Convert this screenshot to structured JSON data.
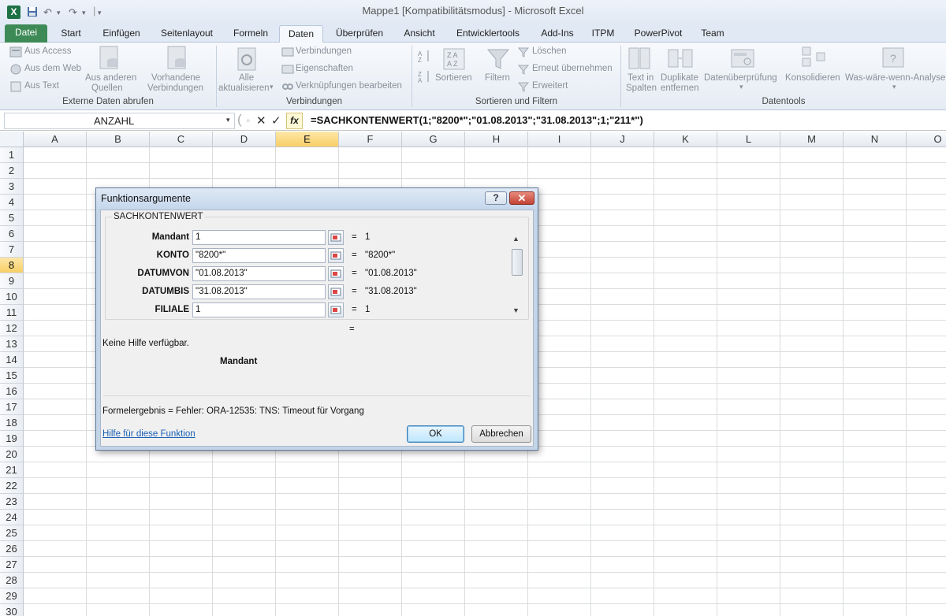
{
  "window": {
    "title": "Mappe1  [Kompatibilitätsmodus]  -  Microsoft Excel",
    "app_icon": "X"
  },
  "quick_access": {
    "save": "save-icon",
    "undo": "undo-icon",
    "redo": "redo-icon"
  },
  "ribbon_tabs": [
    "Datei",
    "Start",
    "Einfügen",
    "Seitenlayout",
    "Formeln",
    "Daten",
    "Überprüfen",
    "Ansicht",
    "Entwicklertools",
    "Add-Ins",
    "ITPM",
    "PowerPivot",
    "Team"
  ],
  "active_tab": "Daten",
  "ribbon": {
    "external": {
      "access": "Aus Access",
      "web": "Aus dem Web",
      "text": "Aus Text",
      "other_1": "Aus anderen",
      "other_2": "Quellen",
      "existing_1": "Vorhandene",
      "existing_2": "Verbindungen",
      "group": "Externe Daten abrufen"
    },
    "connections": {
      "refresh_1": "Alle",
      "refresh_2": "aktualisieren",
      "conn": "Verbindungen",
      "props": "Eigenschaften",
      "links": "Verknüpfungen bearbeiten",
      "group": "Verbindungen"
    },
    "sort": {
      "sort": "Sortieren",
      "filter": "Filtern",
      "clear": "Löschen",
      "reapply": "Erneut übernehmen",
      "advanced": "Erweitert",
      "group": "Sortieren und Filtern"
    },
    "tools": {
      "t2c_1": "Text in",
      "t2c_2": "Spalten",
      "dup_1": "Duplikate",
      "dup_2": "entfernen",
      "validation": "Datenüberprüfung",
      "consolidate": "Konsolidieren",
      "whatif": "Was-wäre-wenn-Analyse",
      "group": "Datentools"
    }
  },
  "formula_bar": {
    "name_box": "ANZAHL",
    "cancel": "✕",
    "enter": "✓",
    "fx": "fx",
    "formula": "=SACHKONTENWERT(1;\"8200*\";\"01.08.2013\";\"31.08.2013\";1;\"211*\")"
  },
  "sheet": {
    "columns": [
      "A",
      "B",
      "C",
      "D",
      "E",
      "F",
      "G",
      "H",
      "I",
      "J",
      "K",
      "L",
      "M",
      "N",
      "O"
    ],
    "selected_column": "E",
    "rows": [
      "1",
      "2",
      "3",
      "4",
      "5",
      "6",
      "7",
      "8",
      "9",
      "10",
      "11",
      "12",
      "13",
      "14",
      "15",
      "16",
      "17",
      "18",
      "19",
      "20",
      "21",
      "22",
      "23",
      "24",
      "25",
      "26",
      "27",
      "28",
      "29",
      "30"
    ],
    "selected_row": "8"
  },
  "dialog": {
    "title": "Funktionsargumente",
    "help_btn": "?",
    "close_btn": "✕",
    "function_name": "SACHKONTENWERT",
    "args": [
      {
        "label": "Mandant",
        "value": "1",
        "result": "1"
      },
      {
        "label": "KONTO",
        "value": "\"8200*\"",
        "result": "\"8200*\""
      },
      {
        "label": "DATUMVON",
        "value": "\"01.08.2013\"",
        "result": "\"01.08.2013\""
      },
      {
        "label": "DATUMBIS",
        "value": "\"31.08.2013\"",
        "result": "\"31.08.2013\""
      },
      {
        "label": "FILIALE",
        "value": "1",
        "result": "1"
      }
    ],
    "eq": "=",
    "total_eq": "=",
    "no_help": "Keine Hilfe verfügbar.",
    "current_arg": "Mandant",
    "result_label": "Formelergebnis =",
    "result_value": "Fehler: ORA-12535: TNS: Timeout für Vorgang",
    "help_link": "Hilfe für diese Funktion",
    "ok": "OK",
    "cancel": "Abbrechen"
  }
}
